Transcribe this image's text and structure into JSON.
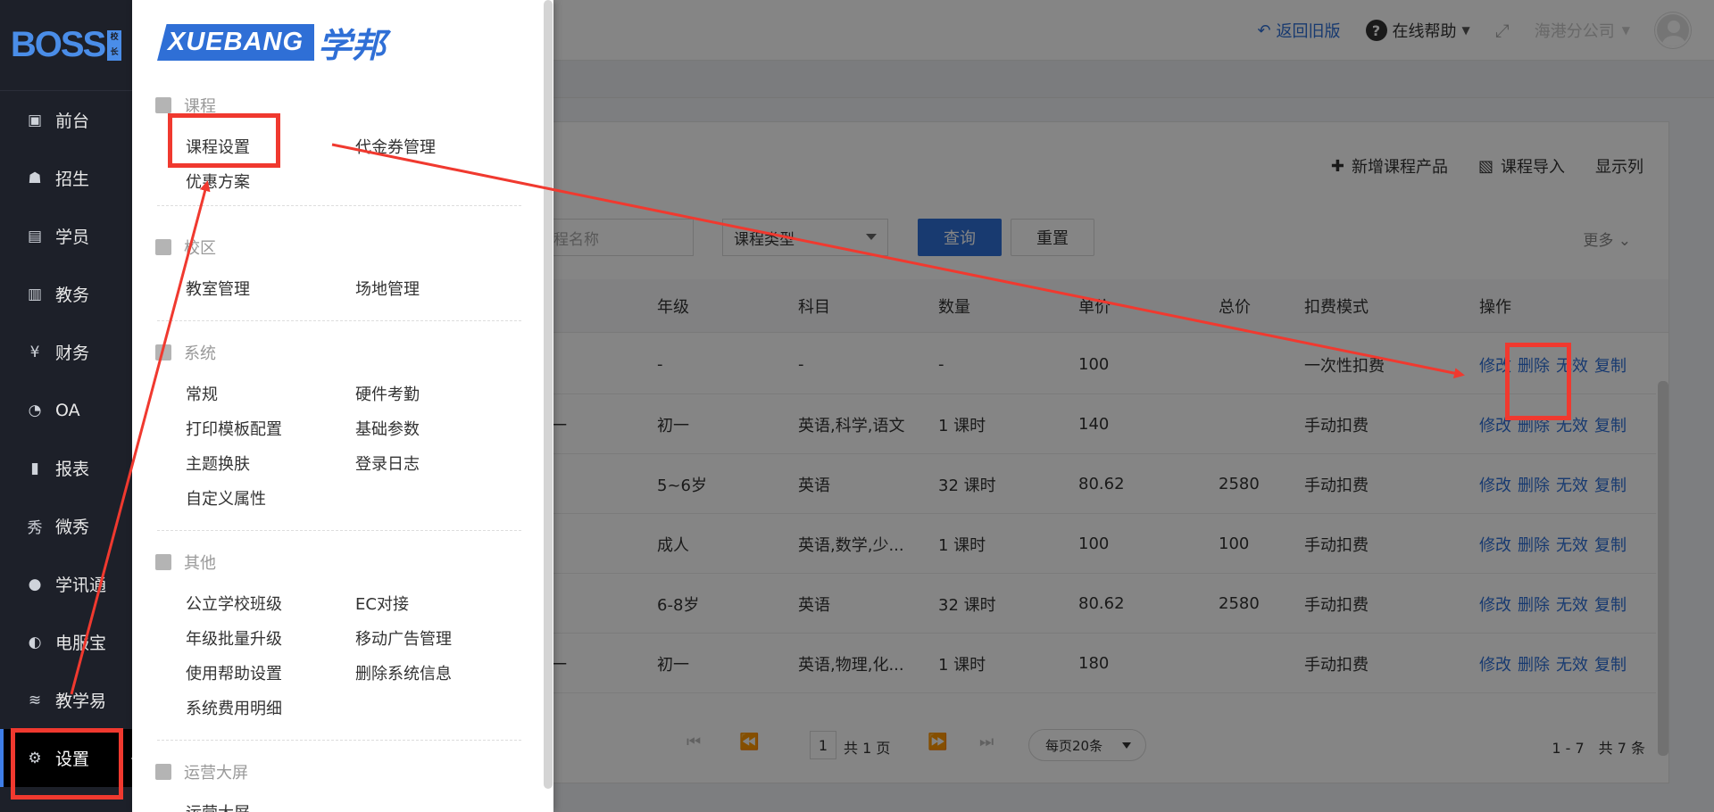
{
  "sidebar": {
    "logo": "BOSS",
    "logo_badge": "校长",
    "items": [
      {
        "label": "前台",
        "icon": "calendar-icon"
      },
      {
        "label": "招生",
        "icon": "user-add-icon"
      },
      {
        "label": "学员",
        "icon": "id-card-icon"
      },
      {
        "label": "教务",
        "icon": "book-icon"
      },
      {
        "label": "财务",
        "icon": "yen-icon"
      },
      {
        "label": "OA",
        "icon": "chat-icon"
      },
      {
        "label": "报表",
        "icon": "bar-chart-icon"
      },
      {
        "label": "微秀",
        "icon": "show-icon"
      },
      {
        "label": "学讯通",
        "icon": "location-icon"
      },
      {
        "label": "电服宝",
        "icon": "phone-icon"
      },
      {
        "label": "教学易",
        "icon": "teach-icon"
      },
      {
        "label": "设置",
        "icon": "gear-icon"
      }
    ]
  },
  "header": {
    "back_label": "返回旧版",
    "help_label": "在线帮助",
    "branch_label": "海港分公司"
  },
  "toolbar": {
    "add_label": "新增课程产品",
    "import_label": "课程导入",
    "columns_label": "显示列"
  },
  "filter": {
    "name_placeholder": "课程名称",
    "type_placeholder": "课程类型",
    "query_label": "查询",
    "reset_label": "重置",
    "more_label": "更多"
  },
  "table": {
    "headers": [
      "年级",
      "科目",
      "数量",
      "单价",
      "总价",
      "扣费模式",
      "操作"
    ],
    "rows": [
      {
        "lead": "",
        "grade": "-",
        "subject": "-",
        "qty": "-",
        "price": "100",
        "total": "",
        "mode": "一次性扣费"
      },
      {
        "lead": "一",
        "grade": "初一",
        "subject": "英语,科学,语文",
        "qty": "1 课时",
        "price": "140",
        "total": "",
        "mode": "手动扣费"
      },
      {
        "lead": "",
        "grade": "5~6岁",
        "subject": "英语",
        "qty": "32 课时",
        "price": "80.62",
        "total": "2580",
        "mode": "手动扣费"
      },
      {
        "lead": "",
        "grade": "成人",
        "subject": "英语,数学,少...",
        "qty": "1 课时",
        "price": "100",
        "total": "100",
        "mode": "手动扣费"
      },
      {
        "lead": "",
        "grade": "6-8岁",
        "subject": "英语",
        "qty": "32 课时",
        "price": "80.62",
        "total": "2580",
        "mode": "手动扣费"
      },
      {
        "lead": "一",
        "grade": "初一",
        "subject": "英语,物理,化...",
        "qty": "1 课时",
        "price": "180",
        "total": "",
        "mode": "手动扣费"
      }
    ],
    "actions": {
      "edit": "修改",
      "delete": "删除",
      "invalid": "无效",
      "copy": "复制"
    }
  },
  "pager": {
    "page": "1",
    "total_pages": "共 1 页",
    "page_size": "每页20条",
    "count": "1 - 7　共 7 条"
  },
  "menu": {
    "brand_en": "XUEBANG",
    "brand_cn": "学邦",
    "sections": [
      {
        "title": "课程",
        "items": [
          "课程设置",
          "代金券管理",
          "优惠方案"
        ]
      },
      {
        "title": "校区",
        "items": [
          "教室管理",
          "场地管理"
        ]
      },
      {
        "title": "系统",
        "items": [
          "常规",
          "硬件考勤",
          "打印模板配置",
          "基础参数",
          "主题换肤",
          "登录日志",
          "自定义属性"
        ]
      },
      {
        "title": "其他",
        "items": [
          "公立学校班级",
          "EC对接",
          "年级批量升级",
          "移动广告管理",
          "使用帮助设置",
          "删除系统信息",
          "系统费用明细"
        ]
      },
      {
        "title": "运营大屏",
        "items": [
          "运营大屏"
        ]
      }
    ]
  },
  "colors": {
    "accent": "#2f6fd6",
    "sidebar_bg": "#1d2029",
    "annotation": "#f0392f"
  }
}
